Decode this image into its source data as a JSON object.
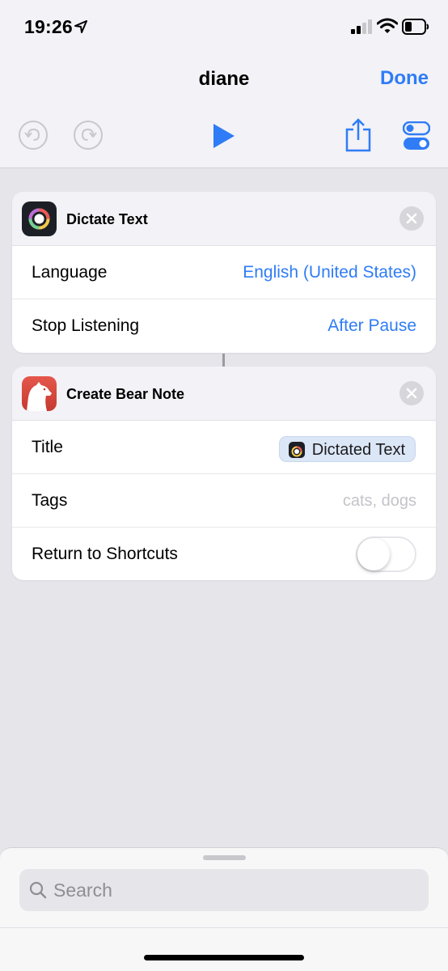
{
  "status_bar": {
    "time": "19:26",
    "icons": [
      "location-arrow-icon",
      "signal-icon",
      "wifi-icon",
      "battery-icon"
    ]
  },
  "nav": {
    "title": "diane",
    "done_label": "Done",
    "toolbar_icons": [
      "undo-icon",
      "redo-icon",
      "play-icon",
      "share-icon",
      "settings-toggle-icon"
    ]
  },
  "actions": [
    {
      "title": "Dictate Text",
      "icon": "dictate-icon",
      "rows": [
        {
          "label": "Language",
          "value": "English (United States)"
        },
        {
          "label": "Stop Listening",
          "value": "After Pause"
        }
      ]
    },
    {
      "title": "Create Bear Note",
      "icon": "bear-app-icon",
      "rows": [
        {
          "label": "Title",
          "token": "Dictated Text"
        },
        {
          "label": "Tags",
          "placeholder": "cats, dogs"
        },
        {
          "label": "Return to Shortcuts",
          "toggle": false
        }
      ]
    }
  ],
  "search": {
    "placeholder": "Search"
  },
  "colors": {
    "accent": "#2f7cf6",
    "background": "#e5e5ea",
    "bear_red": "#d9463a"
  }
}
